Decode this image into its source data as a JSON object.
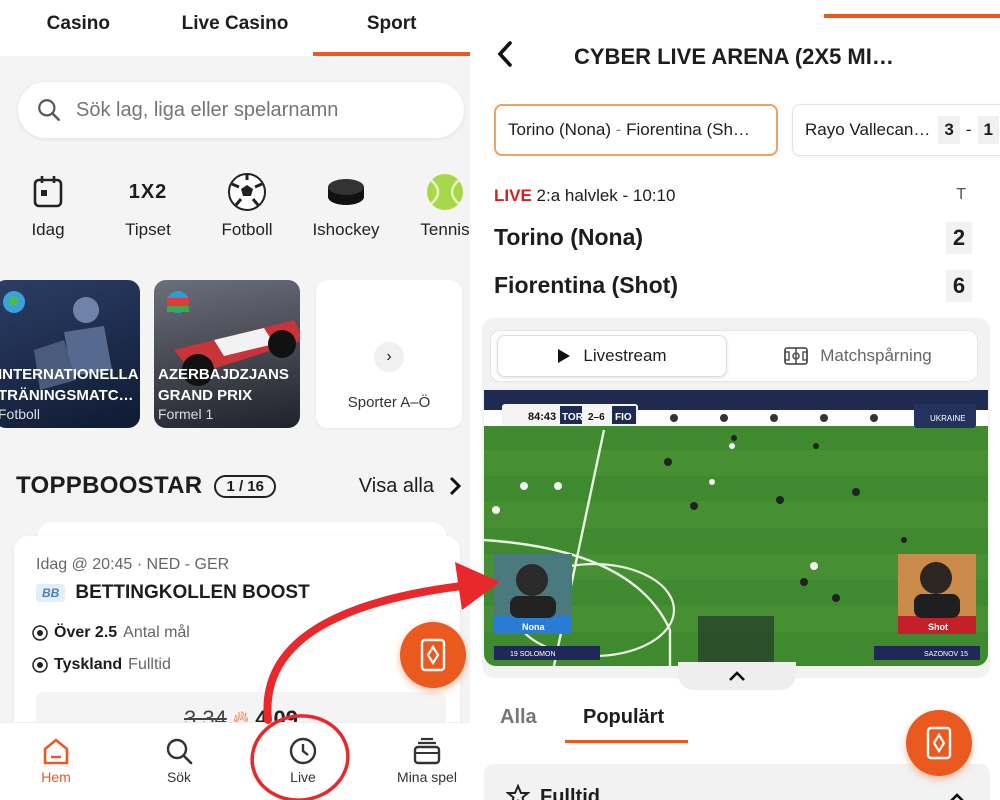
{
  "left": {
    "top_tabs": [
      {
        "label": "Casino",
        "active": false
      },
      {
        "label": "Live Casino",
        "active": false
      },
      {
        "label": "Sport",
        "active": true
      }
    ],
    "search": {
      "placeholder": "Sök lag, liga eller spelarnamn"
    },
    "categories": [
      {
        "label": "Idag",
        "icon": "calendar-icon"
      },
      {
        "label": "Tipset",
        "icon": "1x2-icon",
        "glyph": "1X2"
      },
      {
        "label": "Fotboll",
        "icon": "soccer-ball-icon"
      },
      {
        "label": "Ishockey",
        "icon": "hockey-puck-icon"
      },
      {
        "label": "Tennis",
        "icon": "tennis-ball-icon"
      }
    ],
    "featured_cards": [
      {
        "title_line1": "INTERNATIONELLA",
        "title_line2": "TRÄNINGSMATC…",
        "subtitle": "Fotboll"
      },
      {
        "title_line1": "AZERBAJDZJANS",
        "title_line2": "GRAND PRIX",
        "subtitle": "Formel 1"
      },
      {
        "label": "Sporter A–Ö"
      }
    ],
    "boosts": {
      "heading": "TOPPBOOSTAR",
      "counter": "1 / 16",
      "see_all": "Visa alla",
      "card": {
        "meta": "Idag @ 20:45 · NED - GER",
        "badge": "BB",
        "title": "BETTINGKOLLEN BOOST",
        "rows": [
          {
            "bold": "Över 2.5",
            "grey": "Antal mål"
          },
          {
            "bold": "Tyskland",
            "grey": "Fulltid"
          }
        ],
        "odds_old": "3.34",
        "odds_new": "4.09"
      }
    },
    "bottom_nav": [
      {
        "label": "Hem",
        "icon": "home-icon",
        "active": true
      },
      {
        "label": "Sök",
        "icon": "search-icon",
        "active": false
      },
      {
        "label": "Live",
        "icon": "clock-icon",
        "active": false
      },
      {
        "label": "Mina spel",
        "icon": "betslip-stack-icon",
        "active": false
      }
    ]
  },
  "right": {
    "title": "CYBER LIVE ARENA (2X5 MI…",
    "match_tabs": [
      {
        "label_home": "Torino (Nona)",
        "sep": "-",
        "label_away": "Fiorentina (Sh…",
        "selected": true
      },
      {
        "label": "Rayo Vallecan…",
        "score_home": "3",
        "sep": "-",
        "score_away": "1",
        "selected": false
      }
    ],
    "status": {
      "live": "LIVE",
      "period": "2:a halvlek - 10:10",
      "column": "T"
    },
    "teams": [
      {
        "name": "Torino (Nona)",
        "score": "2"
      },
      {
        "name": "Fiorentina (Shot)",
        "score": "6"
      }
    ],
    "stream_tabs": [
      {
        "label": "Livestream",
        "active": true
      },
      {
        "label": "Matchspårning",
        "active": false
      }
    ],
    "video": {
      "clock": "84:43",
      "home_abbr": "TOR",
      "score": "2–6",
      "away_abbr": "FIO",
      "player_left": "Nona",
      "player_right": "Shot",
      "brand": "UKRAINE",
      "bottom_left": "19 SOLOMON",
      "bottom_right": "SAZONOV 15"
    },
    "market_tabs": [
      {
        "label": "Alla",
        "active": false
      },
      {
        "label": "Populärt",
        "active": true
      }
    ],
    "market_section": {
      "label": "Fulltid"
    }
  },
  "colors": {
    "accent": "#ea5a1e",
    "live_red": "#d42020",
    "annotation_red": "#e8282b",
    "pitch_green": "#3f8a2e"
  }
}
